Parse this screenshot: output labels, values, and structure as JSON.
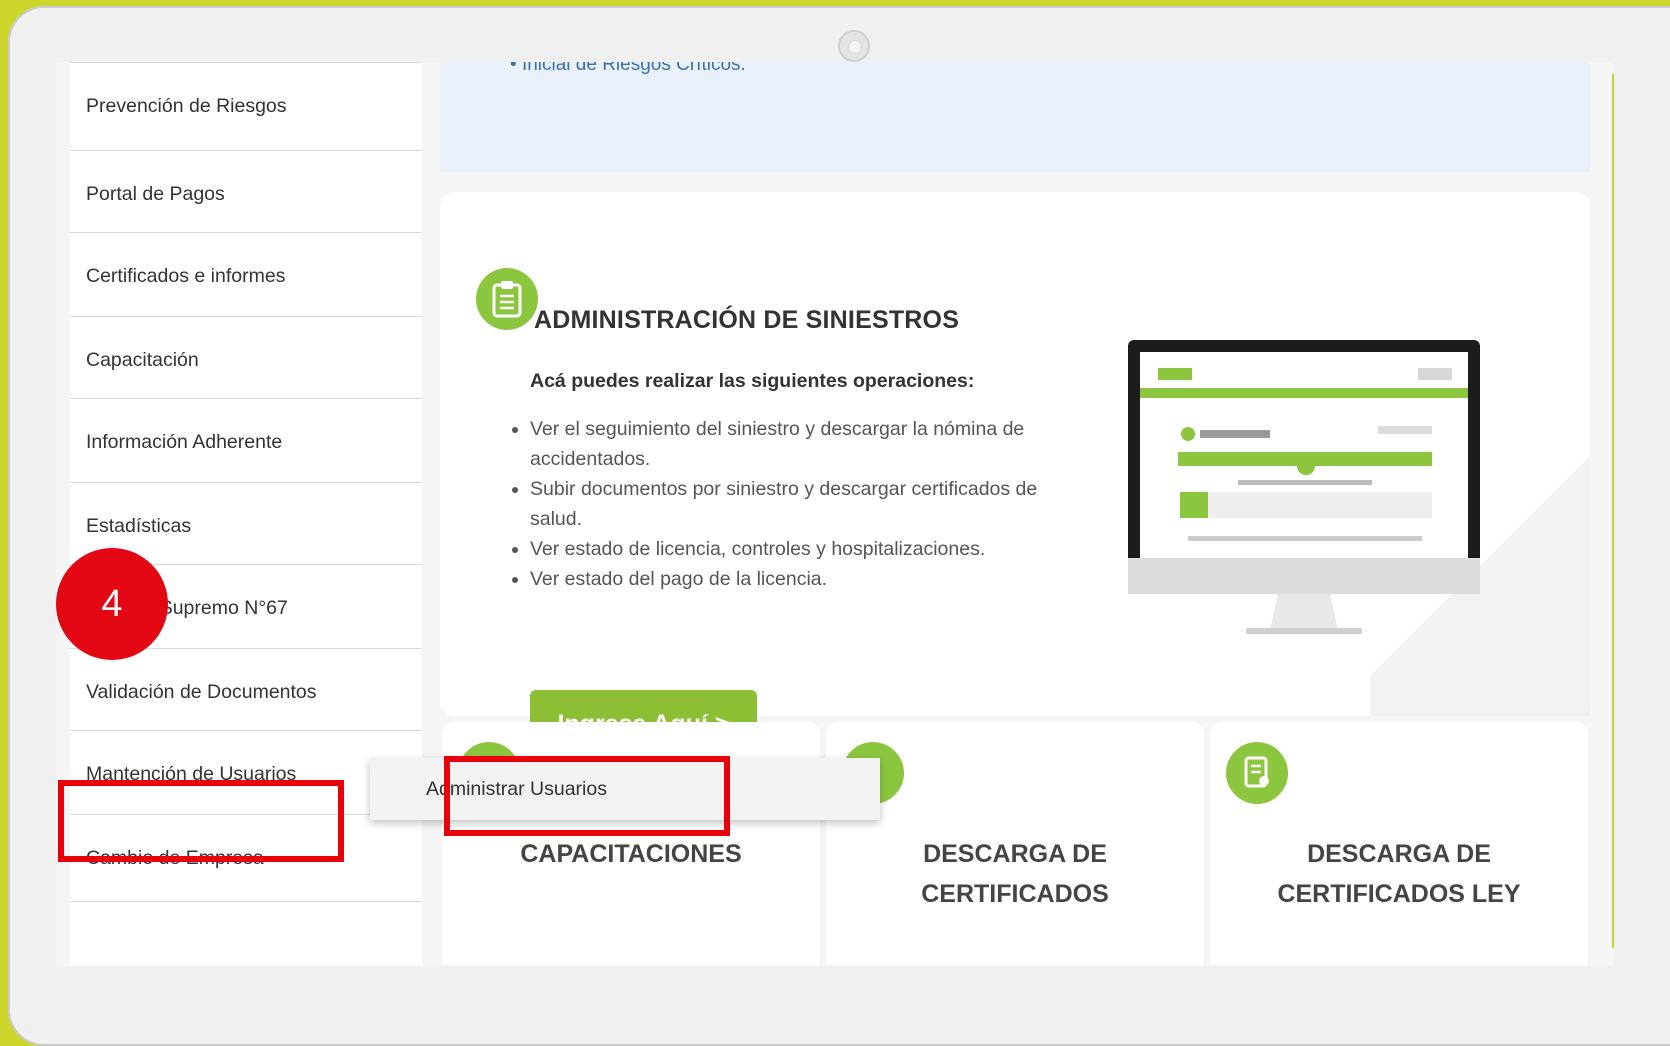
{
  "sidebar": {
    "items": [
      {
        "label": "Prevención de Riesgos"
      },
      {
        "label": "Portal de Pagos"
      },
      {
        "label": "Certificados e informes"
      },
      {
        "label": "Capacitación"
      },
      {
        "label": "Información Adherente"
      },
      {
        "label": "Estadísticas"
      },
      {
        "label": "Decreto Supremo N°67"
      },
      {
        "label": "Validación de Documentos"
      },
      {
        "label": "Mantención de Usuarios"
      },
      {
        "label": "Cambio de Empresa"
      }
    ]
  },
  "top_banner": {
    "bullet": "Inicial de Riesgos Críticos."
  },
  "main_card": {
    "title": "ADMINISTRACIÓN DE SINIESTROS",
    "subtitle": "Acá puedes realizar las siguientes operaciones:",
    "operations": [
      "Ver el seguimiento del siniestro y descargar la nómina de accidentados.",
      "Subir documentos por siniestro y descargar certificados de salud.",
      "Ver estado de licencia, controles y hospitalizaciones.",
      "Ver estado del pago de la licencia."
    ],
    "cta_label": "Ingresa Aquí >",
    "icon": "clipboard-icon"
  },
  "cards": [
    {
      "title": "CAPACITACIONES"
    },
    {
      "title": "DESCARGA DE CERTIFICADOS"
    },
    {
      "title": "DESCARGA DE CERTIFICADOS LEY",
      "icon": "certificate-icon"
    }
  ],
  "dropdown": {
    "item": "Administrar Usuarios"
  },
  "annotation": {
    "step": "4"
  },
  "colors": {
    "accent_green": "#8cc63f",
    "frame_yellow": "#ccd52a",
    "highlight_red": "#e8000b"
  }
}
